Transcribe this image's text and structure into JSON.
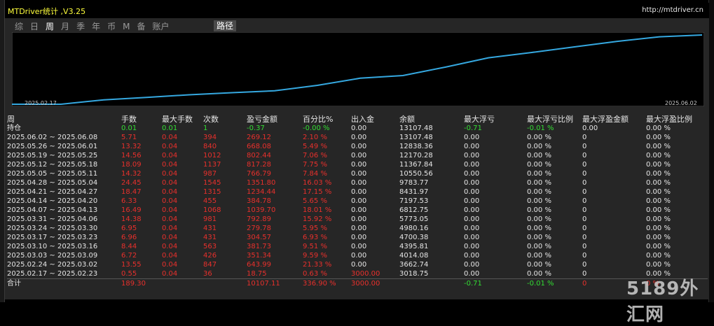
{
  "window": {
    "title": "MTDriver统计 ,V3.25",
    "url": "http://mtdriver.cn"
  },
  "tabs": [
    "综",
    "日",
    "周",
    "月",
    "季",
    "年",
    "币",
    "M",
    "备",
    "账户"
  ],
  "active_tab": "周",
  "path_tab": "路径",
  "chart": {
    "start_label": "2025.02.17",
    "end_label": "2025.06.02",
    "line_color": "#35a8e0",
    "values": [
      3018.75,
      3662.74,
      4014.08,
      4395.81,
      4700.38,
      4980.16,
      5773.05,
      6812.75,
      7197.53,
      8431.97,
      9783.77,
      10550.56,
      11367.84,
      12170.28,
      12838.36,
      13107.48
    ]
  },
  "table": {
    "headers": [
      "周",
      "手数",
      "最大手数",
      "次数",
      "盈亏金额",
      "百分比%",
      "出入金",
      "余额",
      "最大浮亏",
      "最大浮亏比例",
      "最大浮盈金额",
      "最大浮盈比例"
    ],
    "holding": [
      "持仓",
      "0.01",
      "0.01",
      "1",
      "-0.37",
      "-0.00 %",
      "0.00",
      "13107.48",
      "-0.71",
      "-0.01 %",
      "0.00",
      "0.00 %"
    ],
    "rows": [
      [
        "2025.06.02 ~ 2025.06.08",
        "5.71",
        "0.04",
        "394",
        "269.12",
        "2.10 %",
        "0.00",
        "13107.48",
        "0.00",
        "0.00 %",
        "0",
        "0.00 %"
      ],
      [
        "2025.05.26 ~ 2025.06.01",
        "13.32",
        "0.04",
        "840",
        "668.08",
        "5.49 %",
        "0.00",
        "12838.36",
        "0.00",
        "0.00 %",
        "0",
        "0.00 %"
      ],
      [
        "2025.05.19 ~ 2025.05.25",
        "14.56",
        "0.04",
        "1012",
        "802.44",
        "7.06 %",
        "0.00",
        "12170.28",
        "0.00",
        "0.00 %",
        "0",
        "0.00 %"
      ],
      [
        "2025.05.12 ~ 2025.05.18",
        "18.09",
        "0.04",
        "1137",
        "817.28",
        "7.75 %",
        "0.00",
        "11367.84",
        "0.00",
        "0.00 %",
        "0",
        "0.00 %"
      ],
      [
        "2025.05.05 ~ 2025.05.11",
        "14.32",
        "0.04",
        "987",
        "766.79",
        "7.84 %",
        "0.00",
        "10550.56",
        "0.00",
        "0.00 %",
        "0",
        "0.00 %"
      ],
      [
        "2025.04.28 ~ 2025.05.04",
        "24.45",
        "0.04",
        "1545",
        "1351.80",
        "16.03 %",
        "0.00",
        "9783.77",
        "0.00",
        "0.00 %",
        "0",
        "0.00 %"
      ],
      [
        "2025.04.21 ~ 2025.04.27",
        "18.47",
        "0.04",
        "1315",
        "1234.44",
        "17.15 %",
        "0.00",
        "8431.97",
        "0.00",
        "0.00 %",
        "0",
        "0.00 %"
      ],
      [
        "2025.04.14 ~ 2025.04.20",
        "6.33",
        "0.04",
        "455",
        "384.78",
        "5.65 %",
        "0.00",
        "7197.53",
        "0.00",
        "0.00 %",
        "0",
        "0.00 %"
      ],
      [
        "2025.04.07 ~ 2025.04.13",
        "16.49",
        "0.04",
        "1068",
        "1039.70",
        "18.01 %",
        "0.00",
        "6812.75",
        "0.00",
        "0.00 %",
        "0",
        "0.00 %"
      ],
      [
        "2025.03.31 ~ 2025.04.06",
        "14.38",
        "0.04",
        "981",
        "792.89",
        "15.92 %",
        "0.00",
        "5773.05",
        "0.00",
        "0.00 %",
        "0",
        "0.00 %"
      ],
      [
        "2025.03.24 ~ 2025.03.30",
        "6.95",
        "0.04",
        "431",
        "279.78",
        "5.95 %",
        "0.00",
        "4980.16",
        "0.00",
        "0.00 %",
        "0",
        "0.00 %"
      ],
      [
        "2025.03.17 ~ 2025.03.23",
        "6.96",
        "0.04",
        "431",
        "304.57",
        "6.93 %",
        "0.00",
        "4700.38",
        "0.00",
        "0.00 %",
        "0",
        "0.00 %"
      ],
      [
        "2025.03.10 ~ 2025.03.16",
        "8.44",
        "0.04",
        "563",
        "381.73",
        "9.51 %",
        "0.00",
        "4395.81",
        "0.00",
        "0.00 %",
        "0",
        "0.00 %"
      ],
      [
        "2025.03.03 ~ 2025.03.09",
        "6.72",
        "0.04",
        "426",
        "351.34",
        "9.59 %",
        "0.00",
        "4014.08",
        "0.00",
        "0.00 %",
        "0",
        "0.00 %"
      ],
      [
        "2025.02.24 ~ 2025.03.02",
        "13.55",
        "0.04",
        "847",
        "643.99",
        "21.33 %",
        "0.00",
        "3662.74",
        "0.00",
        "0.00 %",
        "0",
        "0.00 %"
      ],
      [
        "2025.02.17 ~ 2025.02.23",
        "0.55",
        "0.04",
        "36",
        "18.75",
        "0.63 %",
        "3000.00",
        "3018.75",
        "0.00",
        "0.00 %",
        "0",
        "0.00 %"
      ]
    ],
    "total": [
      "合计",
      "189.30",
      "",
      "",
      "10107.11",
      "336.90 %",
      "3000.00",
      "",
      "-0.71",
      "-0.01 %",
      "0",
      "0 %"
    ]
  },
  "watermark": "5189外汇网",
  "colors": {
    "title": "#ffff3c",
    "negative_text": "#e8302c",
    "positive_text": "#33dd33",
    "selection": "#7a0000"
  }
}
